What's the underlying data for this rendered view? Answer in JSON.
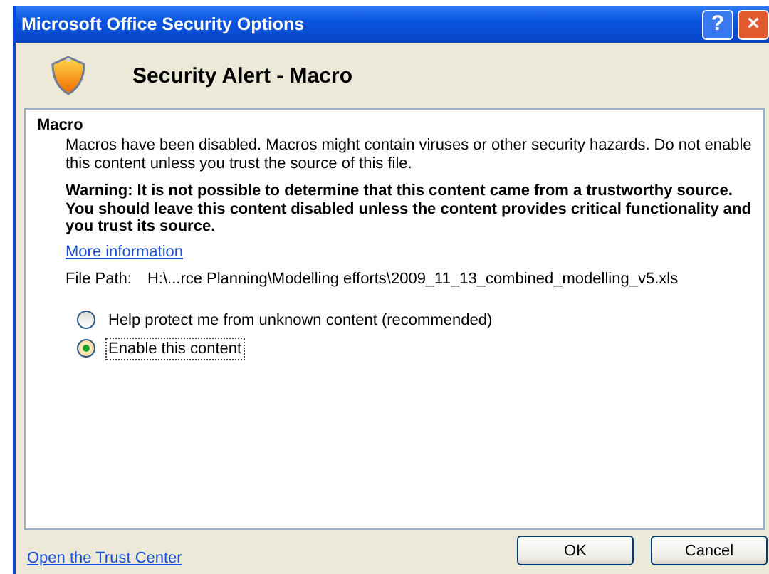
{
  "window": {
    "title": "Microsoft Office Security Options",
    "title_buttons": [
      "?",
      "×"
    ]
  },
  "header": {
    "title": "Security Alert - Macro"
  },
  "section": {
    "title": "Macro",
    "description": "Macros have been disabled. Macros might contain viruses or other security hazards. Do not enable this content unless you trust the source of this file.",
    "warning": "Warning: It is not possible to determine that this content came from a trustworthy source. You should leave this content disabled unless the content provides critical functionality and you trust its source.",
    "link": "More information",
    "file_path_label": "File Path:",
    "file_path": "H:\\...rce Planning\\Modelling efforts\\2009_11_13_combined_modelling_v5.xls"
  },
  "options": [
    {
      "label": "Help protect me from unknown content (recommended)",
      "selected": false
    },
    {
      "label": "Enable this content",
      "selected": true
    }
  ],
  "footer": {
    "link": "Open the Trust Center",
    "buttons": [
      "OK",
      "Cancel"
    ]
  }
}
